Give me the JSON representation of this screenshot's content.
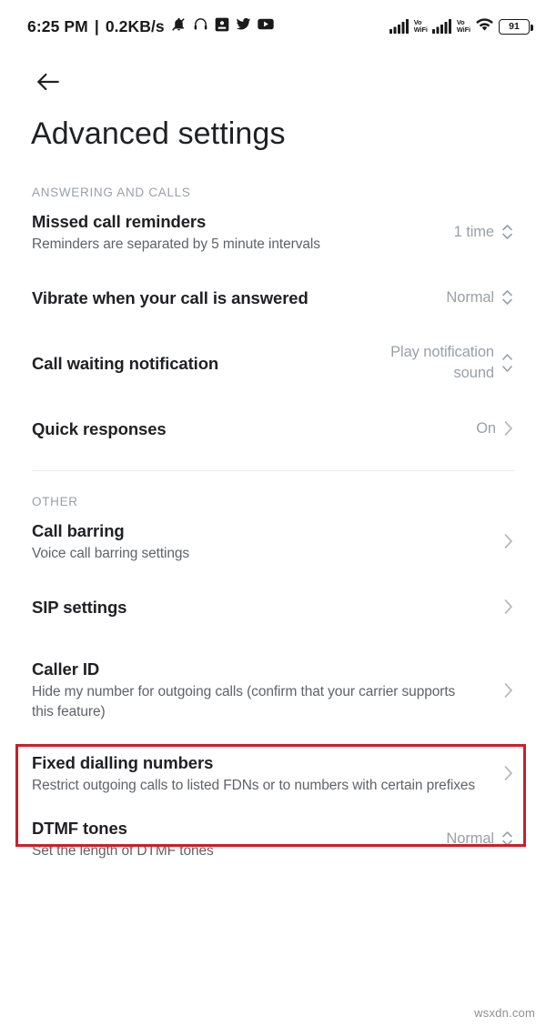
{
  "status_bar": {
    "clock": "6:25 PM",
    "separator": "|",
    "data_rate": "0.2KB/s",
    "left_icons": [
      "bell-muted-icon",
      "headphones-icon",
      "app-square-icon",
      "twitter-icon",
      "youtube-icon"
    ],
    "sim1_label": "Vo\nWiFi",
    "sim1_label_line1": "Vo",
    "sim1_label_line2": "WiFi",
    "sim2_label_line1": "Vo",
    "sim2_label_line2": "WiFi",
    "battery_percent": "91"
  },
  "header": {
    "back_icon": "arrow-left-icon",
    "title": "Advanced settings"
  },
  "sections": [
    {
      "heading": "ANSWERING AND CALLS",
      "items": [
        {
          "title": "Missed call reminders",
          "subtitle": "Reminders are separated by 5 minute intervals",
          "value": "1 time",
          "control": "stepper"
        },
        {
          "title": "Vibrate when your call is answered",
          "subtitle": "",
          "value": "Normal",
          "control": "stepper"
        },
        {
          "title": "Call waiting notification",
          "subtitle": "",
          "value": "Play notification sound",
          "control": "stepper"
        },
        {
          "title": "Quick responses",
          "subtitle": "",
          "value": "On",
          "control": "chevron"
        }
      ]
    },
    {
      "heading": "OTHER",
      "items": [
        {
          "title": "Call barring",
          "subtitle": "Voice call barring settings",
          "value": "",
          "control": "chevron"
        },
        {
          "title": "SIP settings",
          "subtitle": "",
          "value": "",
          "control": "chevron"
        },
        {
          "title": "Caller ID",
          "subtitle": "Hide my number for outgoing calls (confirm that your carrier supports this feature)",
          "value": "",
          "control": "chevron",
          "highlighted": true
        },
        {
          "title": "Fixed dialling numbers",
          "subtitle": "Restrict outgoing calls to listed FDNs or to numbers with certain prefixes",
          "value": "",
          "control": "chevron"
        },
        {
          "title": "DTMF tones",
          "subtitle": "Set the length of DTMF tones",
          "value": "Normal",
          "control": "stepper"
        }
      ]
    }
  ],
  "highlight": {
    "color": "#C8202A"
  },
  "watermark": "wsxdn.com"
}
